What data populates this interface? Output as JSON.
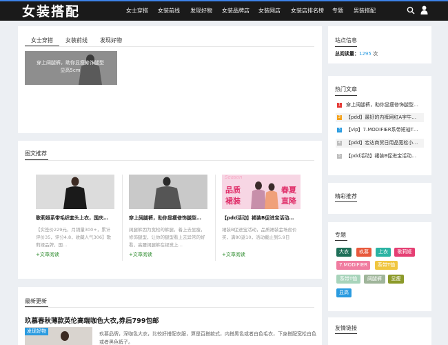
{
  "header": {
    "logo": "女装搭配",
    "nav": [
      "女士穿搭",
      "女装前线",
      "发现好物",
      "女装品牌店",
      "女装网店",
      "女装店排名榜",
      "专题",
      "男装搭配"
    ]
  },
  "top_card": {
    "tabs": [
      "女士穿搭",
      "女装前线",
      "发现好物"
    ],
    "active_tab": 0,
    "thumb_caption": "穿上阔腿裤，助你显瘦修饰腿型显高5cm"
  },
  "featured": {
    "title": "图文推荐",
    "items": [
      {
        "title": "歌莉娅系带毛织套头上衣，国庆…",
        "desc": "【实签价229元，月销量300+，累计评价35，评分4.8，收藏人气306】歌莉娅品牌，国…",
        "link": "+文章阅读"
      },
      {
        "title": "穿上阔腿裤，助你显瘦修饰腿型…",
        "desc": "阔腿裤因为宽松的裤腿，着上去显瘦，修饰腿型，让你的腿型看上去异常的好看，高腰阔腿裤在视觉上…",
        "link": "+文章阅读"
      },
      {
        "title": "【pdd活动】裙装B促进宝活动…",
        "desc": "裙装B促进宝活动，品质裙装金场虑价买，满80返10，活动截止到5.9日",
        "link": "+文章阅读"
      }
    ],
    "banner": {
      "left_top": "品质",
      "left_bottom": "裙装",
      "right_top": "春夏",
      "right_bottom": "直降",
      "script": "Season"
    }
  },
  "latest": {
    "title": "最新更新",
    "article_title": "玖慕春秋薄款英伦高端咖色大衣,券后799包邮",
    "badge": "发现好物",
    "desc": "玖慕品牌，深咖色大衣，比较好搭配衣服，算是百搭款式，内搭黑色或者白色毛衣，下身搭配宽松白色或者黑色裤子。"
  },
  "sidebar": {
    "site_info": {
      "title": "站点信息",
      "label": "总阅读量：",
      "value": "1295",
      "unit": "次"
    },
    "hot": {
      "title": "热门文章",
      "items": [
        {
          "num": "1",
          "text": "穿上阔腿裤，助你显瘦修饰腿型…",
          "color": "#e53935"
        },
        {
          "num": "2",
          "text": "【pdd】最好的内裤网红A字牛…",
          "color": "#f4a21c"
        },
        {
          "num": "3",
          "text": "【vip】7.MODIFIER系带短袖T…",
          "color": "#2a9be0"
        },
        {
          "num": "4",
          "text": "【pdd】宏达商贸日用品宽松小…",
          "color": "#bdbdbd"
        },
        {
          "num": "5",
          "text": "【pdd活动】裙装B促进宝活动…",
          "color": "#bdbdbd"
        }
      ]
    },
    "recommend": {
      "title": "精彩推荐"
    },
    "topics": {
      "title": "专题",
      "tags": [
        {
          "text": "大衣",
          "color": "#1e6f58"
        },
        {
          "text": "玖慕",
          "color": "#e8593c"
        },
        {
          "text": "上衣",
          "color": "#2bb3a3"
        },
        {
          "text": "歌莉娅",
          "color": "#e53f73"
        },
        {
          "text": "7.MODIFIER",
          "color": "#f07ca0"
        },
        {
          "text": "系带T恤",
          "color": "#f0c640"
        },
        {
          "text": "系带T恤",
          "color": "#a8d4bb"
        },
        {
          "text": "阔腿裤",
          "color": "#9fb59a"
        },
        {
          "text": "显瘦",
          "color": "#8c9a2a"
        },
        {
          "text": "显高",
          "color": "#2a9be0"
        }
      ]
    },
    "links": {
      "title": "友情链接"
    }
  }
}
